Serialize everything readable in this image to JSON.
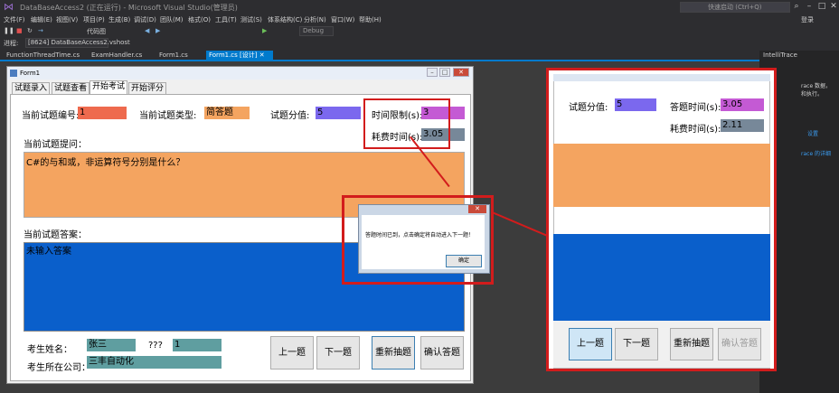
{
  "vs": {
    "title": "DataBaseAccess2 (正在运行) - Microsoft Visual Studio(管理员)",
    "quick_launch": "快速启动 (Ctrl+Q)",
    "login": "登录",
    "menu": [
      "文件(F)",
      "编辑(E)",
      "视图(V)",
      "项目(P)",
      "生成(B)",
      "调试(D)",
      "团队(M)",
      "格式(O)",
      "工具(T)",
      "测试(S)",
      "体系结构(C)",
      "分析(N)",
      "窗口(W)",
      "帮助(H)"
    ],
    "toolbar": {
      "code_view": "代码图",
      "debug_config": "Debug"
    },
    "process_label": "进程:",
    "process_value": "[8624] DataBaseAccess2.vshost",
    "doc_tabs": [
      "FunctionThreadTime.cs",
      "ExamHandler.cs",
      "Form1.cs",
      "Form1.cs [设计]"
    ],
    "intellitrace": {
      "title": "IntelliTrace",
      "line1": "race 数据，",
      "line2": "和执行。",
      "link1": "设置",
      "link2": "race 的详细"
    }
  },
  "form": {
    "title": "Form1",
    "tabs": [
      "试题录入",
      "试题查看",
      "开始考试",
      "开始评分"
    ],
    "active_tab": 2,
    "question_id_label": "当前试题编号:",
    "question_id_value": "1",
    "question_type_label": "当前试题类型:",
    "question_type_value": "简答题",
    "score_label": "试题分值:",
    "score_value": "5",
    "time_limit_label": "时间限制(s):",
    "time_limit_value": "3",
    "time_used_label": "耗费时间(s):",
    "time_used_value": "3.05",
    "question_label": "当前试题提问：",
    "question_text": "C#的与和或，非运算符号分别是什么？",
    "answer_label": "当前试题答案：",
    "answer_text": "未输入答案",
    "name_label": "考生姓名：",
    "name_value": "张三",
    "unknown_label": "???",
    "unknown_value": "1",
    "company_label": "考生所在公司：",
    "company_value": "三丰自动化",
    "buttons": {
      "prev": "上一题",
      "next": "下一题",
      "redraw": "重新抽题",
      "confirm": "确认答题"
    }
  },
  "dialog": {
    "message": "答题时间已到，点击确定将自动进入下一题！",
    "ok": "确定"
  },
  "zoom": {
    "score_label": "试题分值:",
    "score_value": "5",
    "answer_time_label": "答题时间(s):",
    "answer_time_value": "3.05",
    "time_used_label": "耗费时间(s):",
    "time_used_value": "2.11",
    "buttons": {
      "prev": "上一题",
      "next": "下一题",
      "redraw": "重新抽题",
      "confirm": "确认答题"
    }
  },
  "colors": {
    "id_field": "#ee6a4e",
    "type_field": "#f4a460",
    "score_field": "#7b68ee",
    "time_limit_field": "#c45ad4",
    "time_used_field": "#778899",
    "name_field": "#5f9ea0",
    "highlight": "#d21c1c"
  }
}
